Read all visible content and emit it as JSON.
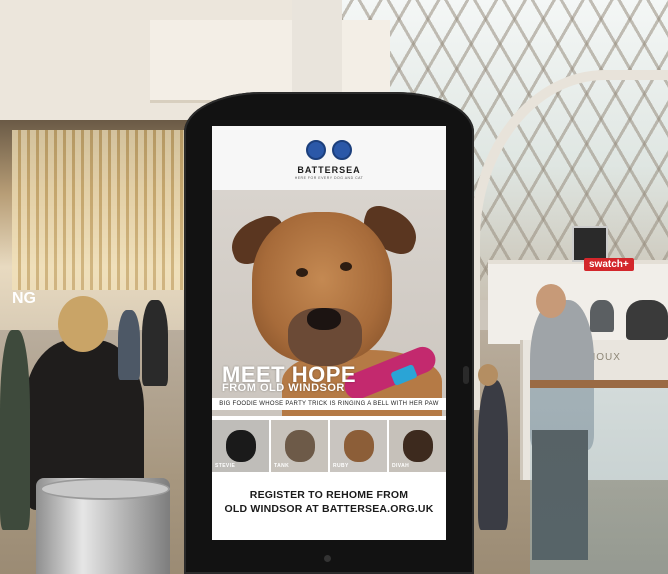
{
  "poster": {
    "brand": "BATTERSEA",
    "tagline": "HERE FOR EVERY DOG AND CAT",
    "headline": "MEET HOPE",
    "subheadline": "FROM OLD WINDSOR",
    "caption": "BIG FOODIE WHOSE PARTY TRICK IS RINGING A BELL WITH HER PAW",
    "pets": [
      {
        "name": "STEVIE"
      },
      {
        "name": "TANK"
      },
      {
        "name": "RUBY"
      },
      {
        "name": "DIVAH"
      }
    ],
    "cta_line1": "REGISTER TO REHOME FROM",
    "cta_line2": "OLD WINDSOR AT BATTERSEA.ORG.UK"
  },
  "background": {
    "store_sign_left": "NG",
    "shop_sign": "swatch+",
    "counter_sign": "HOUX"
  },
  "colors": {
    "brand_blue": "#2b58a8",
    "collar_pink": "#c3296e",
    "tag_blue": "#2aa4d6",
    "kiosk_frame": "#121212"
  }
}
